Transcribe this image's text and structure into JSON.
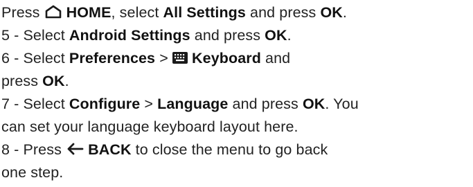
{
  "lines": [
    {
      "segments": [
        {
          "t": "Press "
        },
        {
          "icon": "home-icon"
        },
        {
          "t": " HOME",
          "b": true
        },
        {
          "t": ", select "
        },
        {
          "t": "All Settings",
          "b": true
        },
        {
          "t": " and press  "
        },
        {
          "t": "OK",
          "b": true
        },
        {
          "t": "."
        }
      ]
    },
    {
      "segments": [
        {
          "t": "5 - Select "
        },
        {
          "t": "Android Settings",
          "b": true
        },
        {
          "t": " and press  "
        },
        {
          "t": "OK",
          "b": true
        },
        {
          "t": "."
        }
      ]
    },
    {
      "segments": [
        {
          "t": "6 - Select "
        },
        {
          "t": "Preferences",
          "b": true
        },
        {
          "t": " >  "
        },
        {
          "icon": "keyboard-icon"
        },
        {
          "t": " Keyboard",
          "b": true
        },
        {
          "t": "  and"
        }
      ]
    },
    {
      "segments": [
        {
          "t": "press "
        },
        {
          "t": "OK",
          "b": true
        },
        {
          "t": "."
        }
      ]
    },
    {
      "segments": [
        {
          "t": "7 - Select "
        },
        {
          "t": "Configure",
          "b": true
        },
        {
          "t": " > "
        },
        {
          "t": "Language",
          "b": true
        },
        {
          "t": " and press "
        },
        {
          "t": "OK",
          "b": true
        },
        {
          "t": ". You"
        }
      ]
    },
    {
      "segments": [
        {
          "t": "can set your language keyboard layout here."
        }
      ]
    },
    {
      "segments": [
        {
          "t": "8 - Press "
        },
        {
          "icon": "back-arrow-icon"
        },
        {
          "t": " BACK",
          "b": true
        },
        {
          "t": " to close the menu to go back"
        }
      ]
    },
    {
      "segments": [
        {
          "t": "one step."
        }
      ]
    }
  ]
}
